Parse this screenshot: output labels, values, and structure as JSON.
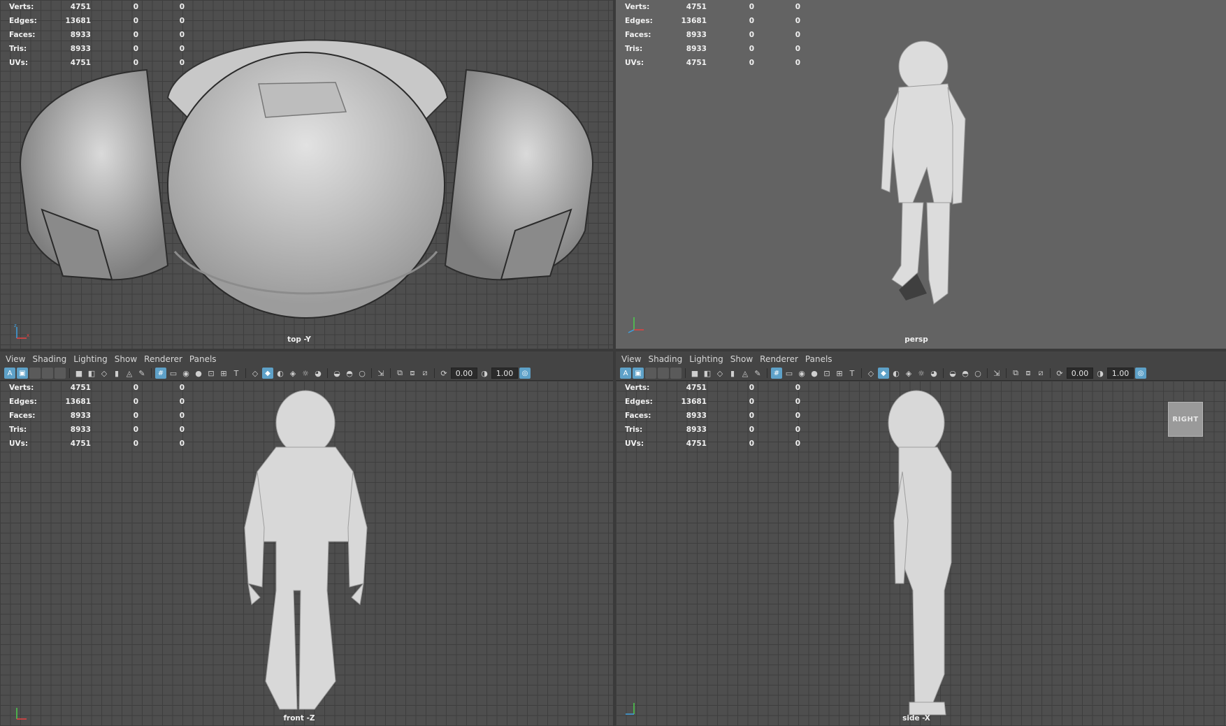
{
  "stats": {
    "labels": [
      "Verts:",
      "Edges:",
      "Faces:",
      "Tris:",
      "UVs:"
    ],
    "values": [
      [
        "4751",
        "0",
        "0"
      ],
      [
        "13681",
        "0",
        "0"
      ],
      [
        "8933",
        "0",
        "0"
      ],
      [
        "8933",
        "0",
        "0"
      ],
      [
        "4751",
        "0",
        "0"
      ]
    ]
  },
  "menus": [
    "View",
    "Shading",
    "Lighting",
    "Show",
    "Renderer",
    "Panels"
  ],
  "toolbar": {
    "field_a": "0.00",
    "field_b": "1.00"
  },
  "viewports": {
    "top": {
      "camera": "top -Y"
    },
    "persp": {
      "camera": "persp"
    },
    "front": {
      "camera": "front -Z"
    },
    "side": {
      "camera": "side -X"
    }
  },
  "viewcube": {
    "label": "RIGHT"
  },
  "icons": [
    "select-icon",
    "camera-icon",
    "grid-icon",
    "wireframe-icon",
    "smooth-shade-icon",
    "textured-icon",
    "light-icon",
    "isolate-icon",
    "xray-icon",
    "exposure-icon",
    "gamma-icon",
    "color-management-icon"
  ],
  "colors": {
    "accent": "#5ea1c8",
    "viewport_grid": "#4e4e4e",
    "menubar": "#444444"
  }
}
